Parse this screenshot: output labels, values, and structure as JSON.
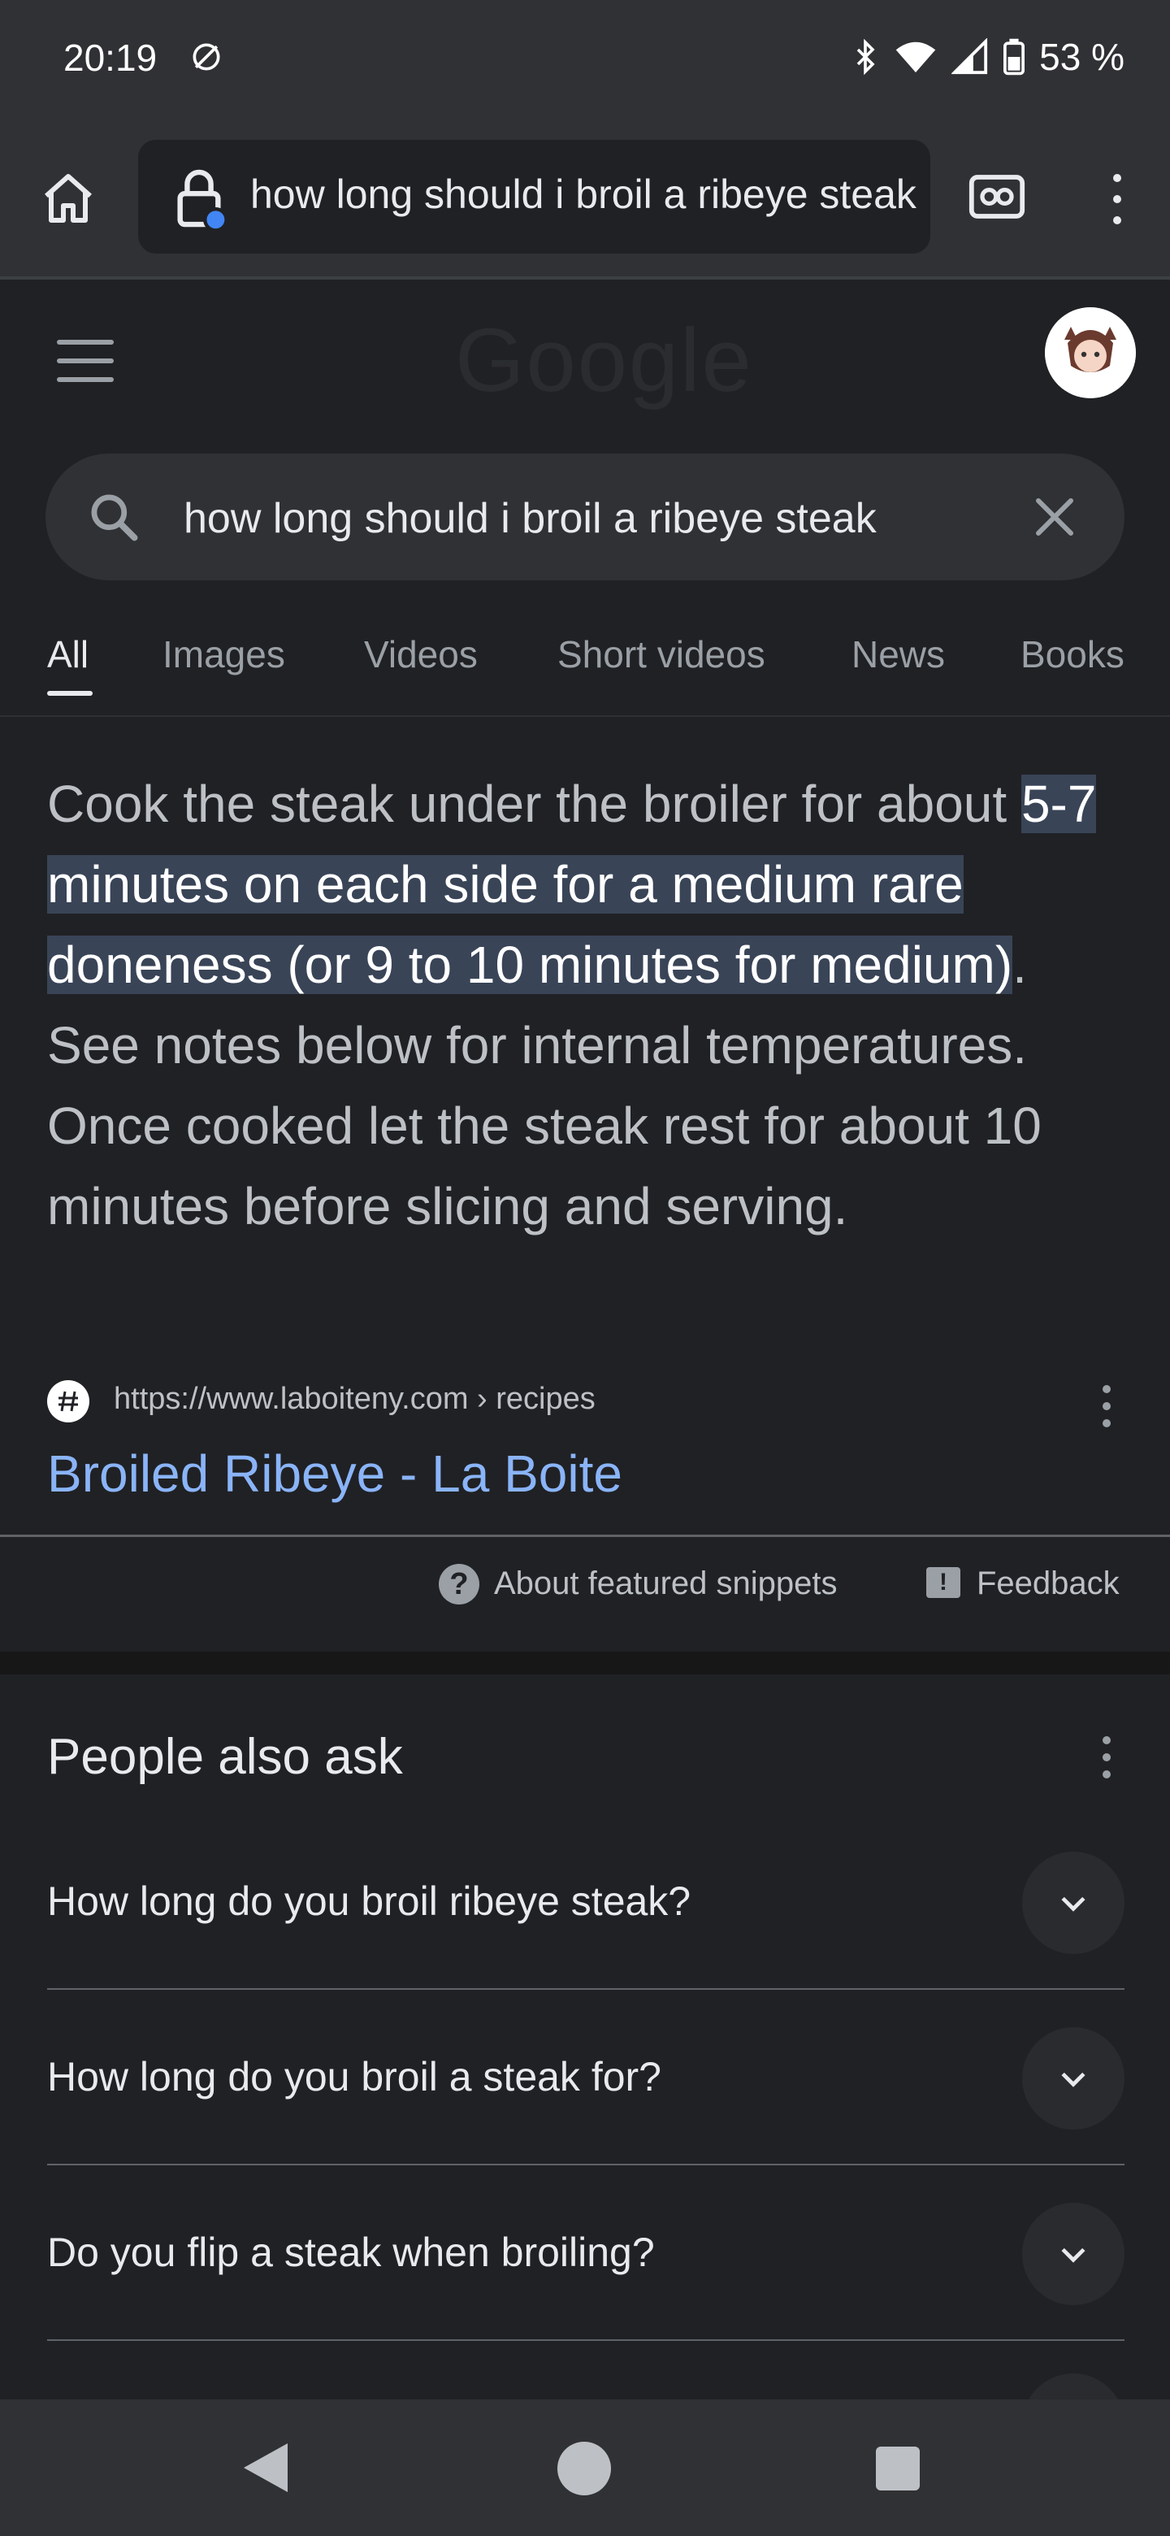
{
  "status_bar": {
    "time": "20:19",
    "battery": "53 %",
    "icons": [
      "data-saver-icon",
      "bluetooth-icon",
      "wifi-icon",
      "signal-icon",
      "battery-icon"
    ]
  },
  "browser": {
    "url": "how long should i broil a ribeye steak",
    "icons": [
      "home-icon",
      "lock-icon",
      "incognito-tabs-icon",
      "more-vert-icon"
    ]
  },
  "google": {
    "logo": "Google",
    "search_query": "how long should i broil a ribeye steak"
  },
  "tabs": [
    "All",
    "Images",
    "Videos",
    "Short videos",
    "News",
    "Books"
  ],
  "snippet": {
    "before": "Cook the steak under the broiler for about ",
    "highlight": "5-7 minutes on each side for a medium rare doneness (or 9 to 10 minutes for medium)",
    "after": ". See notes below for internal temperatures. Once cooked let the steak rest for about 10 minutes before slicing and serving.",
    "source_url": "https://www.laboiteny.com › recipes",
    "source_title": "Broiled Ribeye - La Boite",
    "about_label": "About featured snippets",
    "feedback_label": "Feedback"
  },
  "people_also_ask": {
    "title": "People also ask",
    "questions": [
      "How long do you broil ribeye steak?",
      "How long do you broil a steak for?",
      "Do you flip a steak when broiling?"
    ]
  },
  "colors": {
    "background": "#202124",
    "chrome": "#303134",
    "highlight": "#394457",
    "link": "#8ab4f8"
  }
}
